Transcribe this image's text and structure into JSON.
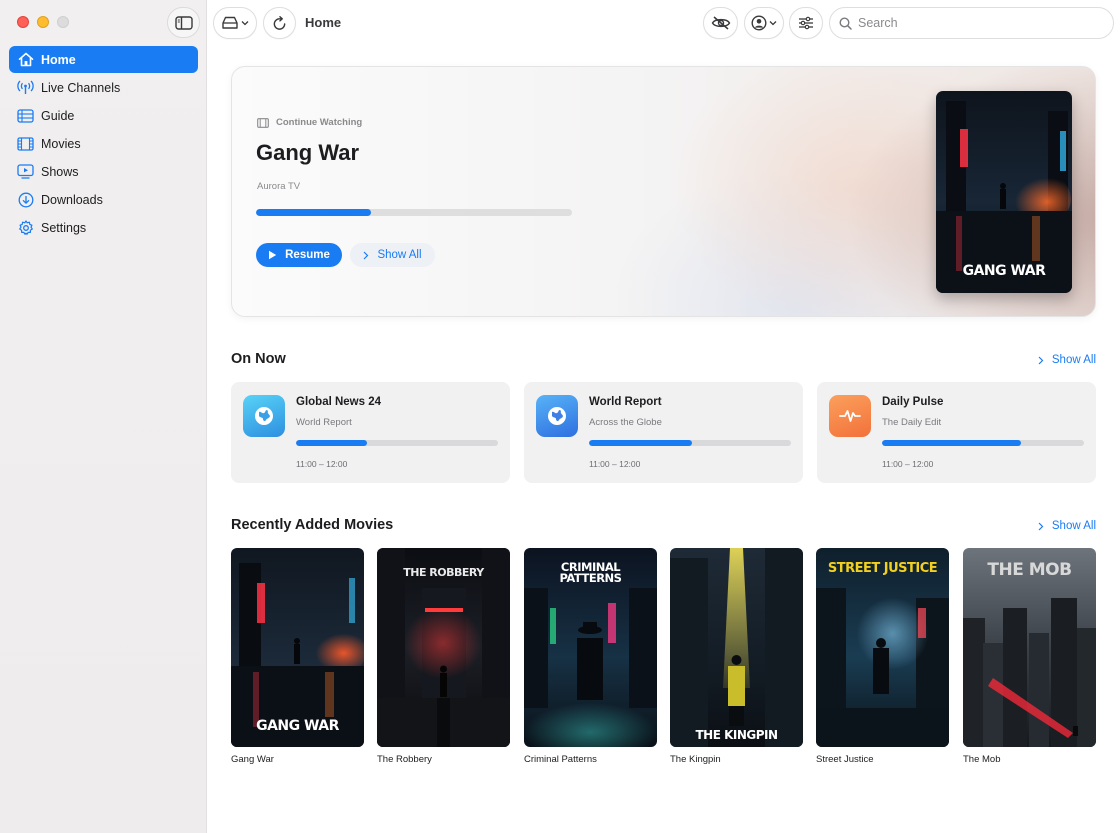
{
  "window": {
    "title": "Home"
  },
  "sidebar": {
    "items": [
      {
        "label": "Home",
        "icon": "house-icon",
        "active": true
      },
      {
        "label": "Live Channels",
        "icon": "antenna-icon",
        "active": false
      },
      {
        "label": "Guide",
        "icon": "list-icon",
        "active": false
      },
      {
        "label": "Movies",
        "icon": "film-icon",
        "active": false
      },
      {
        "label": "Shows",
        "icon": "tv-icon",
        "active": false
      },
      {
        "label": "Downloads",
        "icon": "download-icon",
        "active": false
      },
      {
        "label": "Settings",
        "icon": "gear-icon",
        "active": false
      }
    ]
  },
  "toolbar": {
    "title": "Home",
    "search_placeholder": "Search"
  },
  "hero": {
    "eyebrow": "Continue Watching",
    "title": "Gang War",
    "subtitle": "Aurora TV",
    "progress": 0.365,
    "resume_label": "Resume",
    "show_all_label": "Show All",
    "poster_text": "GANG WAR"
  },
  "on_now": {
    "title": "On Now",
    "show_all_label": "Show All",
    "cards": [
      {
        "channel": "Global News 24",
        "program": "World Report",
        "time": "11:00 – 12:00",
        "progress": 0.35,
        "icon": "globe-icon",
        "color": "#3fb0e8"
      },
      {
        "channel": "World Report",
        "program": "Across the Globe",
        "time": "11:00 – 12:00",
        "progress": 0.51,
        "icon": "globe-icon",
        "color": "#3f8ce8"
      },
      {
        "channel": "Daily Pulse",
        "program": "The Daily Edit",
        "time": "11:00 – 12:00",
        "progress": 0.69,
        "icon": "pulse-icon",
        "color": "#f58a4a"
      }
    ]
  },
  "recent_movies": {
    "title": "Recently Added Movies",
    "show_all_label": "Show All",
    "items": [
      {
        "title": "Gang War",
        "poster_text": "GANG WAR"
      },
      {
        "title": "The Robbery",
        "poster_text": "THE ROBBERY"
      },
      {
        "title": "Criminal Patterns",
        "poster_text": "CRIMINAL PATTERNS"
      },
      {
        "title": "The Kingpin",
        "poster_text": "THE KINGPIN"
      },
      {
        "title": "Street Justice",
        "poster_text": "STREET JUSTICE"
      },
      {
        "title": "The Mob",
        "poster_text": "THE MOB"
      }
    ]
  },
  "colors": {
    "accent": "#1a7cf3"
  }
}
